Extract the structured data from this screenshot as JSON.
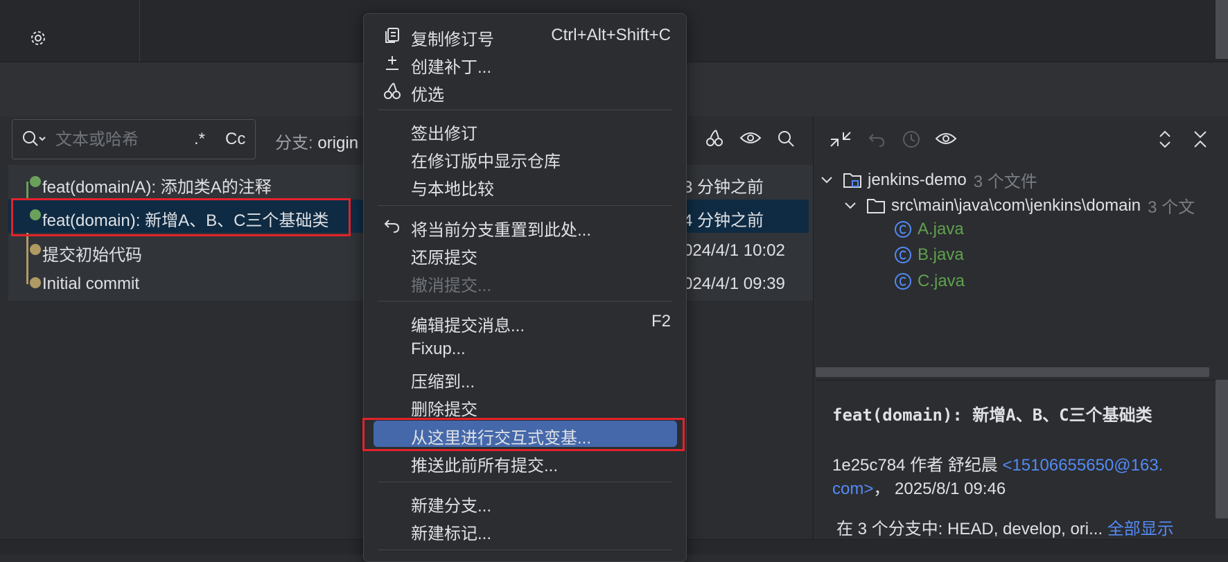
{
  "search": {
    "placeholder": "文本或哈希",
    "regex_label": ".*",
    "case_label": "Cc"
  },
  "branch_filter": {
    "label": "分支:",
    "value": "origin"
  },
  "commits": [
    {
      "message": "feat(domain/A): 添加类A的注释",
      "date": "3 分钟之前"
    },
    {
      "message": "feat(domain): 新增A、B、C三个基础类",
      "date": "4 分钟之前"
    },
    {
      "message": "提交初始代码",
      "date": "024/4/1 10:02"
    },
    {
      "message": "Initial commit",
      "date": "024/4/1 09:39"
    }
  ],
  "tree": {
    "root_name": "jenkins-demo",
    "root_count": "3 个文件",
    "folder_name": "src\\main\\java\\com\\jenkins\\domain",
    "folder_count": "3 个文",
    "files": [
      "A.java",
      "B.java",
      "C.java"
    ]
  },
  "details": {
    "subject": "feat(domain): 新增A、B、C三个基础类",
    "meta_prefix": "1e25c784 作者 舒纪晨 ",
    "email_part1": "<15106655650@163.",
    "email_part2": "com>",
    "date_part": "， 2025/8/1 09:46",
    "branches_text": "在 3 个分支中: HEAD, develop, ori...",
    "show_all": "全部显示"
  },
  "menu": {
    "items": [
      {
        "label": "复制修订号",
        "shortcut": "Ctrl+Alt+Shift+C",
        "icon": "copy-icon"
      },
      {
        "label": "创建补丁...",
        "icon": "patch-icon"
      },
      {
        "label": "优选",
        "icon": "cherry-pick-icon"
      },
      {
        "label": "签出修订"
      },
      {
        "label": "在修订版中显示仓库"
      },
      {
        "label": "与本地比较"
      },
      {
        "label": "将当前分支重置到此处...",
        "icon": "reset-icon"
      },
      {
        "label": "还原提交"
      },
      {
        "label": "撤消提交..."
      },
      {
        "label": "编辑提交消息...",
        "shortcut": "F2"
      },
      {
        "label": "Fixup..."
      },
      {
        "label": "压缩到..."
      },
      {
        "label": "删除提交"
      },
      {
        "label": "从这里进行交互式变基..."
      },
      {
        "label": "推送此前所有提交..."
      },
      {
        "label": "新建分支..."
      },
      {
        "label": "新建标记..."
      }
    ]
  },
  "colors": {
    "selection": "#0f2b43",
    "menu_highlight": "#4468aa",
    "red_box": "#e3232c",
    "graph_green": "#6aa15a",
    "graph_gold": "#b09a63",
    "link": "#548af7"
  }
}
